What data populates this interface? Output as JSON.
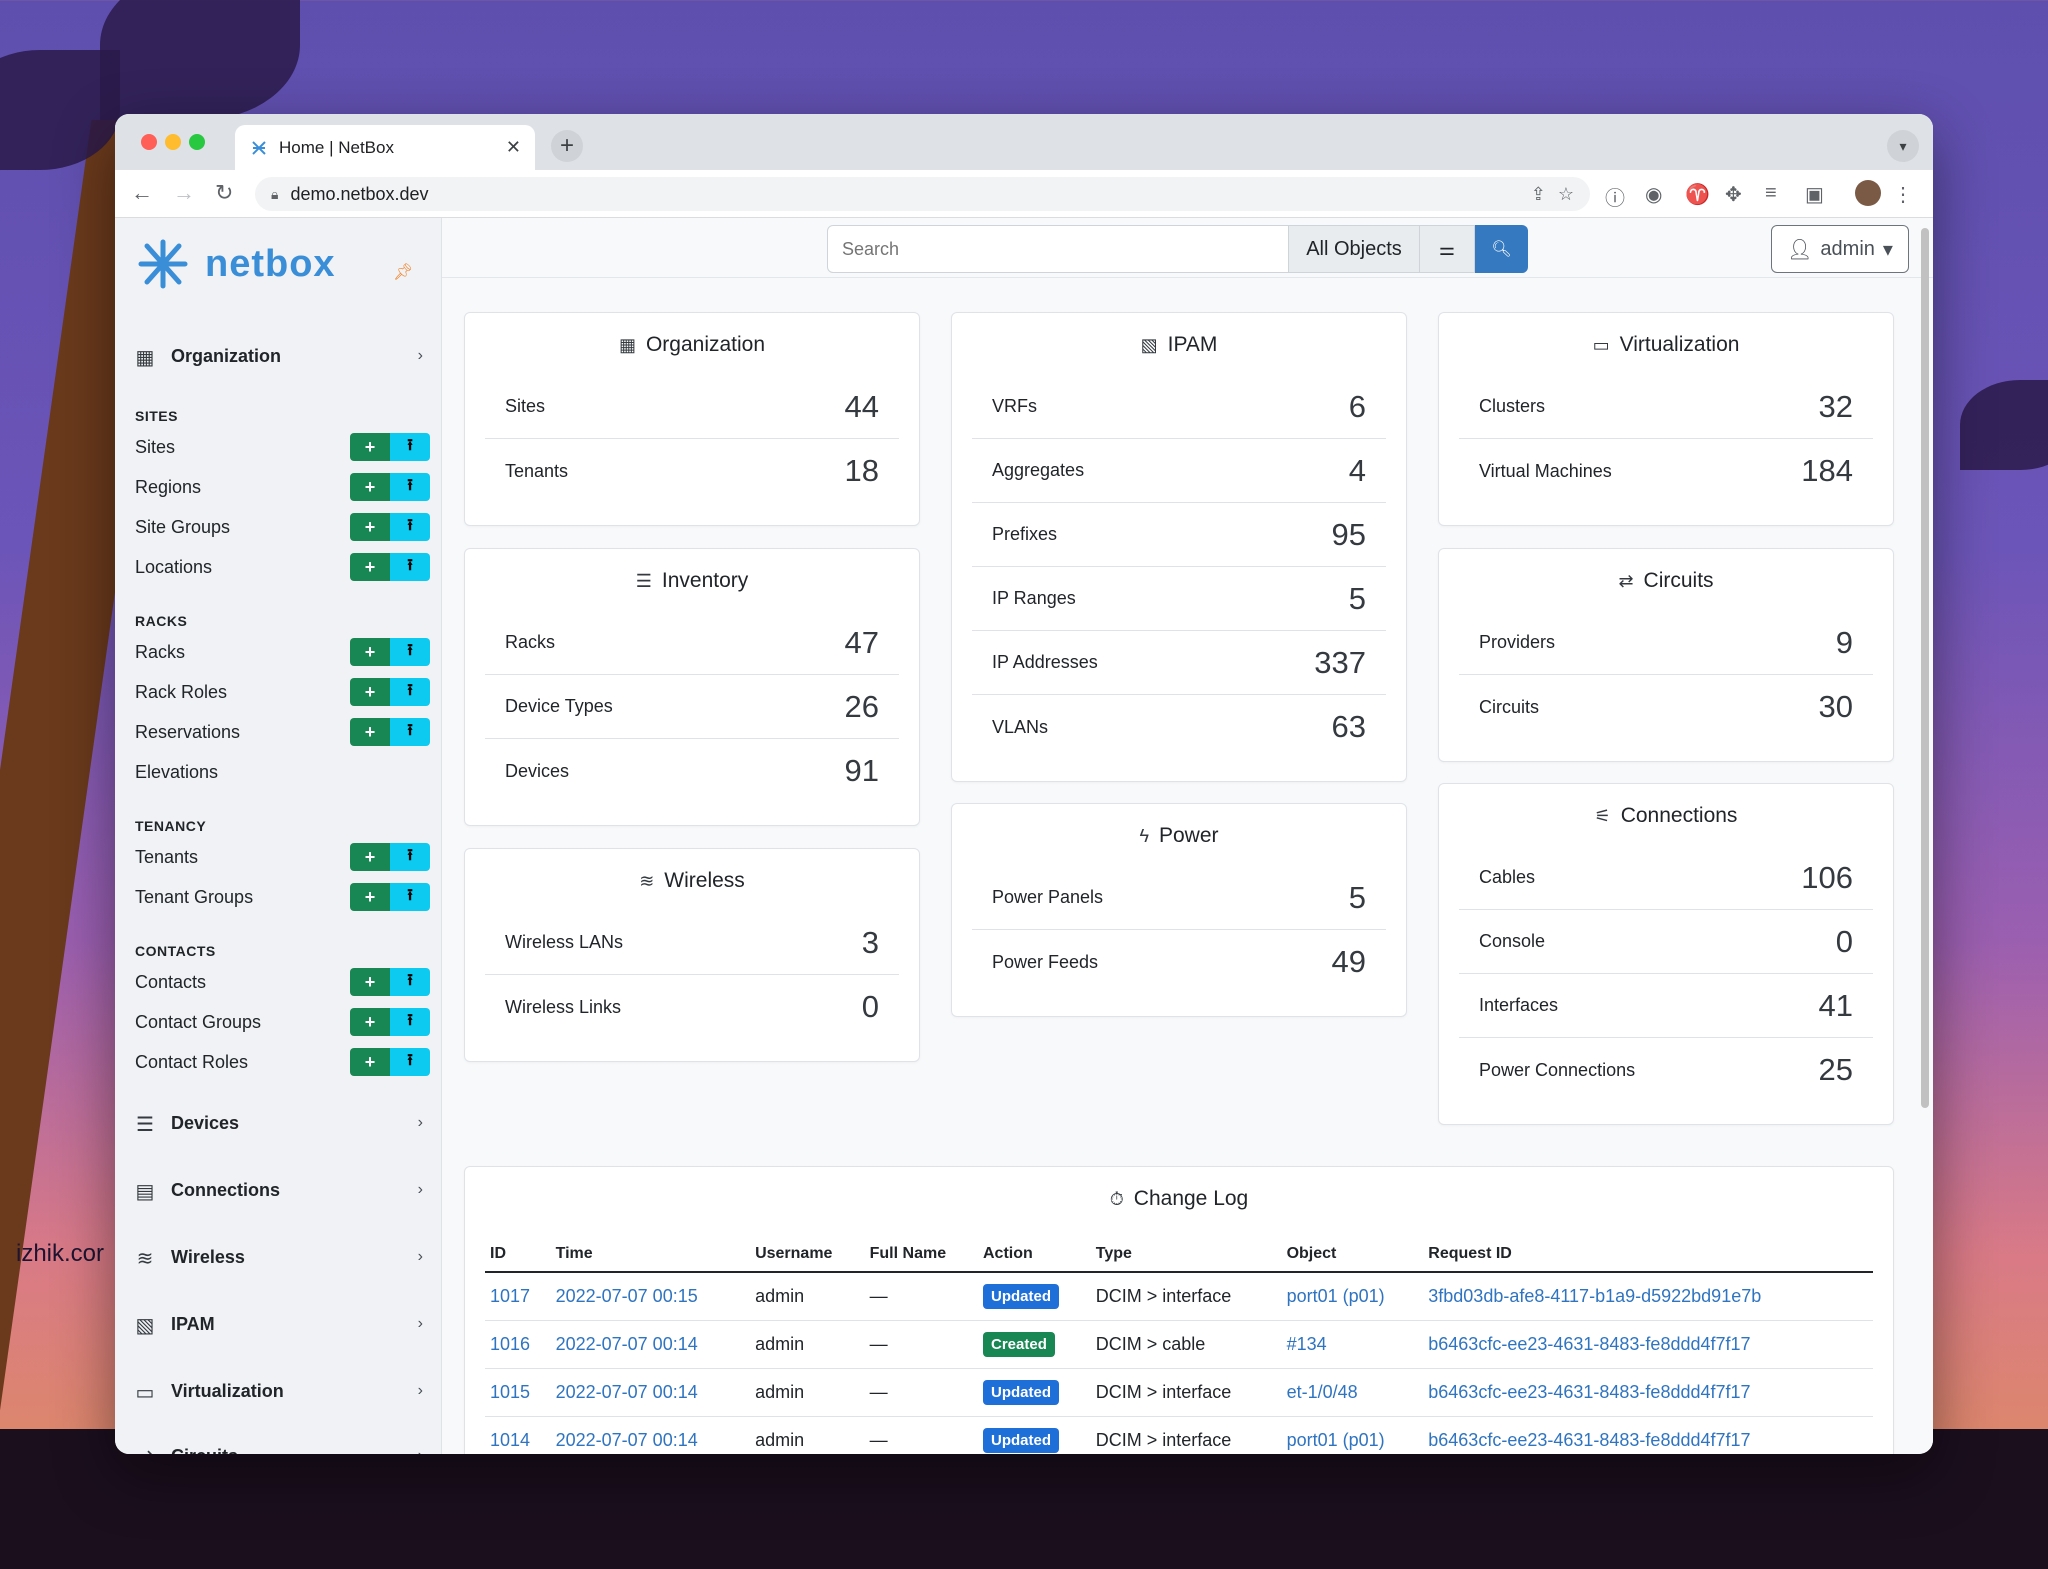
{
  "watermark": "izhik.cor",
  "browser": {
    "tab_title": "Home | NetBox",
    "tab_close": "✕",
    "new_tab": "+",
    "url": "demo.netbox.dev"
  },
  "app": {
    "logo_text": "netbox"
  },
  "sidebar": {
    "groups": [
      {
        "label": "Organization"
      },
      {
        "label": "Devices"
      },
      {
        "label": "Connections"
      },
      {
        "label": "Wireless"
      },
      {
        "label": "IPAM"
      },
      {
        "label": "Virtualization"
      },
      {
        "label": "Circuits"
      }
    ],
    "sections": [
      {
        "heading": "SITES",
        "items": [
          "Sites",
          "Regions",
          "Site Groups",
          "Locations"
        ]
      },
      {
        "heading": "RACKS",
        "items": [
          "Racks",
          "Rack Roles",
          "Reservations",
          "Elevations"
        ]
      },
      {
        "heading": "TENANCY",
        "items": [
          "Tenants",
          "Tenant Groups"
        ]
      },
      {
        "heading": "CONTACTS",
        "items": [
          "Contacts",
          "Contact Groups",
          "Contact Roles"
        ]
      }
    ],
    "add_label": "+",
    "import_label": "⭱"
  },
  "search": {
    "placeholder": "Search",
    "scope": "All Objects"
  },
  "user": {
    "name": "admin"
  },
  "cards": {
    "organization": {
      "title": "Organization",
      "rows": [
        {
          "label": "Sites",
          "value": "44"
        },
        {
          "label": "Tenants",
          "value": "18"
        }
      ]
    },
    "ipam": {
      "title": "IPAM",
      "rows": [
        {
          "label": "VRFs",
          "value": "6"
        },
        {
          "label": "Aggregates",
          "value": "4"
        },
        {
          "label": "Prefixes",
          "value": "95"
        },
        {
          "label": "IP Ranges",
          "value": "5"
        },
        {
          "label": "IP Addresses",
          "value": "337"
        },
        {
          "label": "VLANs",
          "value": "63"
        }
      ]
    },
    "virtualization": {
      "title": "Virtualization",
      "rows": [
        {
          "label": "Clusters",
          "value": "32"
        },
        {
          "label": "Virtual Machines",
          "value": "184"
        }
      ]
    },
    "inventory": {
      "title": "Inventory",
      "rows": [
        {
          "label": "Racks",
          "value": "47"
        },
        {
          "label": "Device Types",
          "value": "26"
        },
        {
          "label": "Devices",
          "value": "91"
        }
      ]
    },
    "circuits": {
      "title": "Circuits",
      "rows": [
        {
          "label": "Providers",
          "value": "9"
        },
        {
          "label": "Circuits",
          "value": "30"
        }
      ]
    },
    "wireless": {
      "title": "Wireless",
      "rows": [
        {
          "label": "Wireless LANs",
          "value": "3"
        },
        {
          "label": "Wireless Links",
          "value": "0"
        }
      ]
    },
    "power": {
      "title": "Power",
      "rows": [
        {
          "label": "Power Panels",
          "value": "5"
        },
        {
          "label": "Power Feeds",
          "value": "49"
        }
      ]
    },
    "connections": {
      "title": "Connections",
      "rows": [
        {
          "label": "Cables",
          "value": "106"
        },
        {
          "label": "Console",
          "value": "0"
        },
        {
          "label": "Interfaces",
          "value": "41"
        },
        {
          "label": "Power Connections",
          "value": "25"
        }
      ]
    }
  },
  "changelog": {
    "title": "Change Log",
    "columns": [
      "ID",
      "Time",
      "Username",
      "Full Name",
      "Action",
      "Type",
      "Object",
      "Request ID"
    ],
    "rows": [
      {
        "id": "1017",
        "time": "2022-07-07 00:15",
        "user": "admin",
        "full_name": "—",
        "action": "Updated",
        "type": "DCIM > interface",
        "object": "port01 (p01)",
        "request_id": "3fbd03db-afe8-4117-b1a9-d5922bd91e7b"
      },
      {
        "id": "1016",
        "time": "2022-07-07 00:14",
        "user": "admin",
        "full_name": "—",
        "action": "Created",
        "type": "DCIM > cable",
        "object": "#134",
        "request_id": "b6463cfc-ee23-4631-8483-fe8ddd4f7f17"
      },
      {
        "id": "1015",
        "time": "2022-07-07 00:14",
        "user": "admin",
        "full_name": "—",
        "action": "Updated",
        "type": "DCIM > interface",
        "object": "et-1/0/48",
        "request_id": "b6463cfc-ee23-4631-8483-fe8ddd4f7f17"
      },
      {
        "id": "1014",
        "time": "2022-07-07 00:14",
        "user": "admin",
        "full_name": "—",
        "action": "Updated",
        "type": "DCIM > interface",
        "object": "port01 (p01)",
        "request_id": "b6463cfc-ee23-4631-8483-fe8ddd4f7f17"
      }
    ]
  }
}
